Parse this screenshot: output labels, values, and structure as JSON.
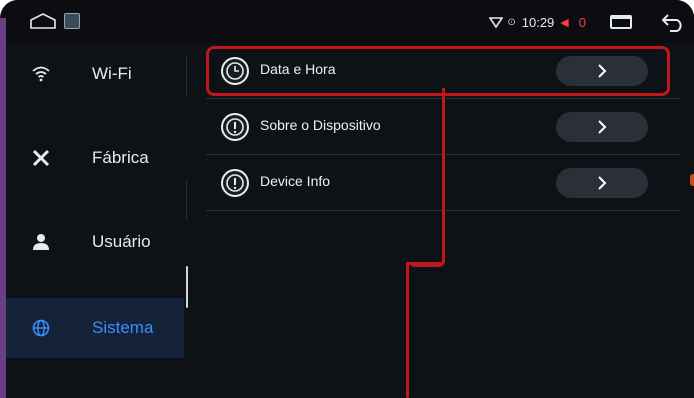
{
  "status_bar": {
    "time": "10:29",
    "volume_indicator": "◀",
    "count": "0",
    "icons": [
      "home-outline-icon",
      "image-thumbnail-icon",
      "wifi-icon",
      "location-icon",
      "recents-icon",
      "back-icon"
    ]
  },
  "sidebar": {
    "items": [
      {
        "label": "Wi-Fi",
        "icon": "wifi-icon",
        "active": false
      },
      {
        "label": "Fábrica",
        "icon": "tools-icon",
        "active": false
      },
      {
        "label": "Usuário",
        "icon": "user-icon",
        "active": false
      },
      {
        "label": "Sistema",
        "icon": "globe-icon",
        "active": true
      }
    ]
  },
  "main": {
    "rows": [
      {
        "label": "Data e Hora",
        "icon": "clock-icon",
        "highlighted": true
      },
      {
        "label": "Sobre o Dispositivo",
        "icon": "info-icon",
        "highlighted": false
      },
      {
        "label": "Device Info",
        "icon": "info-icon",
        "highlighted": false
      }
    ]
  },
  "colors": {
    "accent": "#3a8dff",
    "highlight_border": "#c0171d",
    "background": "#0e1116"
  }
}
